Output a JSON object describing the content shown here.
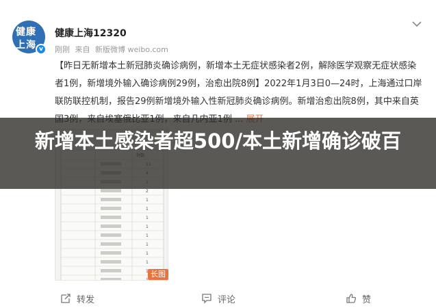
{
  "post": {
    "avatar_line1": "健康",
    "avatar_line2": "上海",
    "verified_mark": "v",
    "author": "健康上海12320",
    "meta": {
      "time": "刚刚",
      "source_prefix": "来自",
      "source": "新版微博 weibo.com"
    },
    "text_main": "【昨日无新增本土新冠肺炎确诊病例，新增本土无症状感染者2例，解除医学观察无症状感染者1例，新增境外输入确诊病例29例，治愈出院8例】2022年1月3日0—24时，上海通过口岸联防联控机制，报告29例新增境外输入性新冠肺炎确诊病例。新增治愈出院8例，其中来自英国3例，来自埃塞俄比亚1例，来自几内亚1例 ...",
    "text_more": "展开",
    "image_tag": "长图",
    "table_values": [
      "11",
      "4",
      "1",
      "2",
      "1",
      "1",
      "1",
      "1",
      "1",
      "1",
      "1",
      "1",
      "1",
      "1"
    ],
    "table_header_count": "例数"
  },
  "overlay": {
    "headline": "新增本土感染者超500/本土新增确诊破百"
  },
  "actions": {
    "share": "转发",
    "comment": "评论",
    "like": "赞"
  },
  "icons": {
    "more": "chevron-down-icon",
    "share": "share-icon",
    "comment": "comment-icon",
    "like": "thumbs-up-icon"
  },
  "colors": {
    "accent": "#eb7340",
    "avatar_bg": "#2f6fb3",
    "verified": "#1e88e5"
  }
}
